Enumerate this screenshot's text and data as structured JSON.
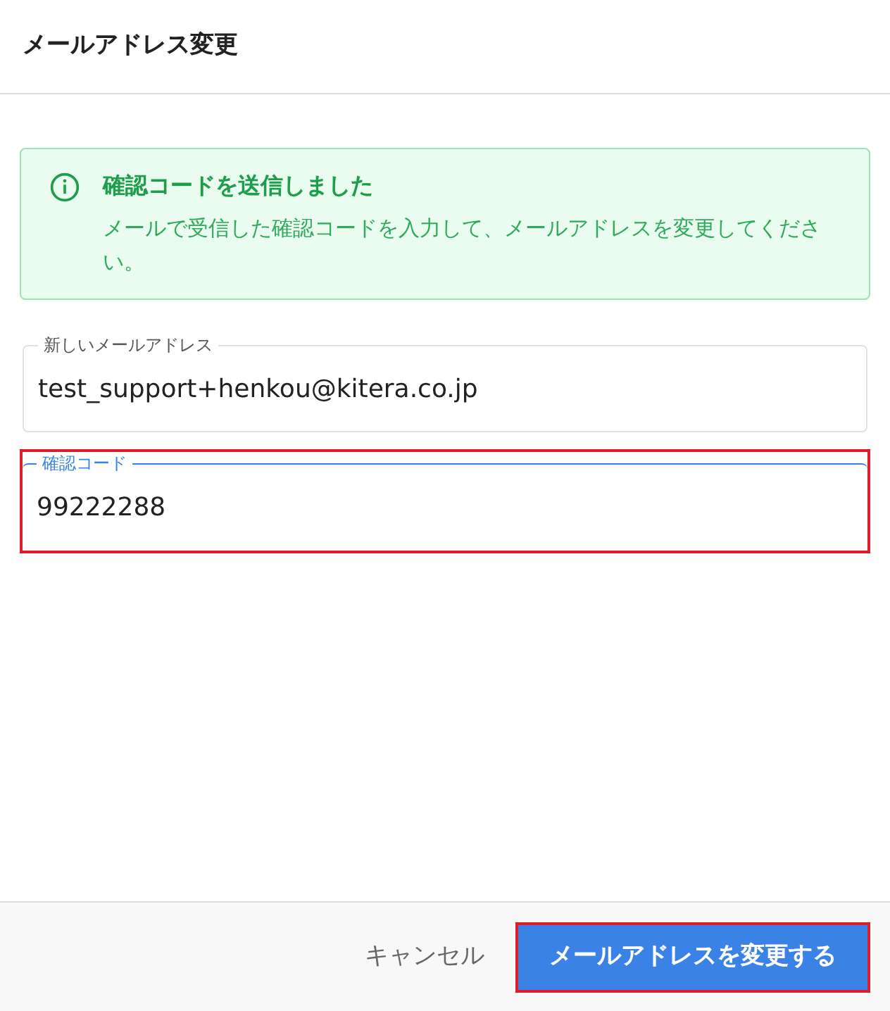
{
  "dialog": {
    "title": "メールアドレス変更"
  },
  "alert": {
    "title": "確認コードを送信しました",
    "message": "メールで受信した確認コードを入力して、メールアドレスを変更してください。"
  },
  "fields": [
    {
      "label": "新しいメールアドレス",
      "value": "test_support+henkou@kitera.co.jp",
      "focused": false,
      "highlighted": false
    },
    {
      "label": "確認コード",
      "value": "99222288",
      "focused": true,
      "highlighted": true
    }
  ],
  "buttons": [
    {
      "kind": "text",
      "label": "キャンセル",
      "highlighted": false
    },
    {
      "kind": "primary",
      "label": "メールアドレスを変更する",
      "highlighted": true
    }
  ]
}
